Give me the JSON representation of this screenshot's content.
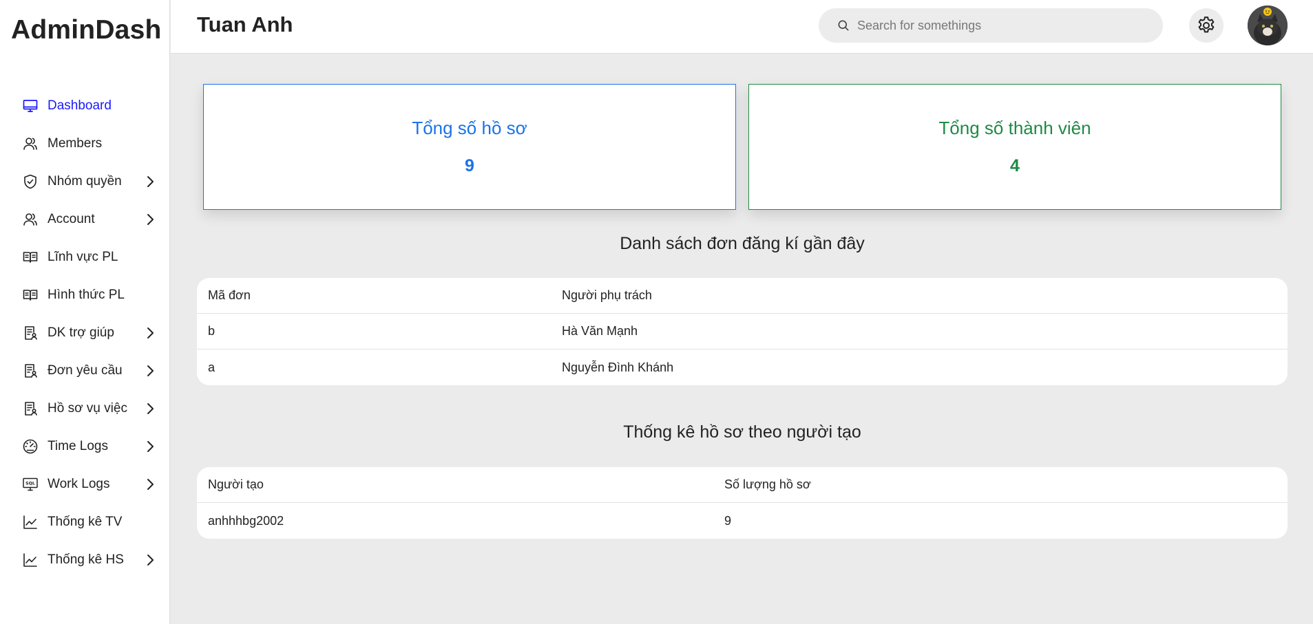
{
  "brand": "AdminDash",
  "header": {
    "user_name": "Tuan Anh",
    "search_placeholder": "Search for somethings"
  },
  "sidebar": {
    "items": [
      {
        "label": "Dashboard",
        "icon": "monitor-icon",
        "active": true
      },
      {
        "label": "Members",
        "icon": "users-icon"
      },
      {
        "label": "Nhóm quyền",
        "icon": "shield-icon",
        "has_submenu": true
      },
      {
        "label": "Account",
        "icon": "users-icon",
        "has_submenu": true
      },
      {
        "label": "Lĩnh vực PL",
        "icon": "book-icon"
      },
      {
        "label": "Hình thức PL",
        "icon": "book-icon"
      },
      {
        "label": "DK trợ giúp",
        "icon": "document-user-icon",
        "has_submenu": true
      },
      {
        "label": "Đơn yêu cầu",
        "icon": "document-user-icon",
        "has_submenu": true
      },
      {
        "label": "Hồ sơ vụ việc",
        "icon": "document-user-icon",
        "has_submenu": true
      },
      {
        "label": "Time Logs",
        "icon": "gauge-icon",
        "has_submenu": true
      },
      {
        "label": "Work Logs",
        "icon": "sql-monitor-icon",
        "has_submenu": true
      },
      {
        "label": "Thống kê TV",
        "icon": "line-chart-icon"
      },
      {
        "label": "Thống kê HS",
        "icon": "line-chart-icon",
        "has_submenu": true
      }
    ]
  },
  "cards": {
    "records": {
      "title": "Tổng số hồ sơ",
      "value": "9",
      "color": "#1a73e8"
    },
    "members": {
      "title": "Tổng số thành viên",
      "value": "4",
      "color": "#1e8a45"
    }
  },
  "recent_applications": {
    "title": "Danh sách đơn đăng kí gần đây",
    "headers": [
      "Mã đơn",
      "Người phụ trách"
    ],
    "rows": [
      [
        "b",
        "Hà Văn Mạnh"
      ],
      [
        "a",
        "Nguyễn Đình Khánh"
      ]
    ]
  },
  "records_by_creator": {
    "title": "Thống kê hồ sơ theo người tạo",
    "headers": [
      "Người tạo",
      "Số lượng hồ sơ"
    ],
    "rows": [
      [
        "anhhhbg2002",
        "9"
      ]
    ]
  },
  "colors": {
    "active_nav": "#1a1aff",
    "accent_blue": "#1a73e8",
    "accent_green": "#1e8a45",
    "background": "#ebebeb"
  }
}
